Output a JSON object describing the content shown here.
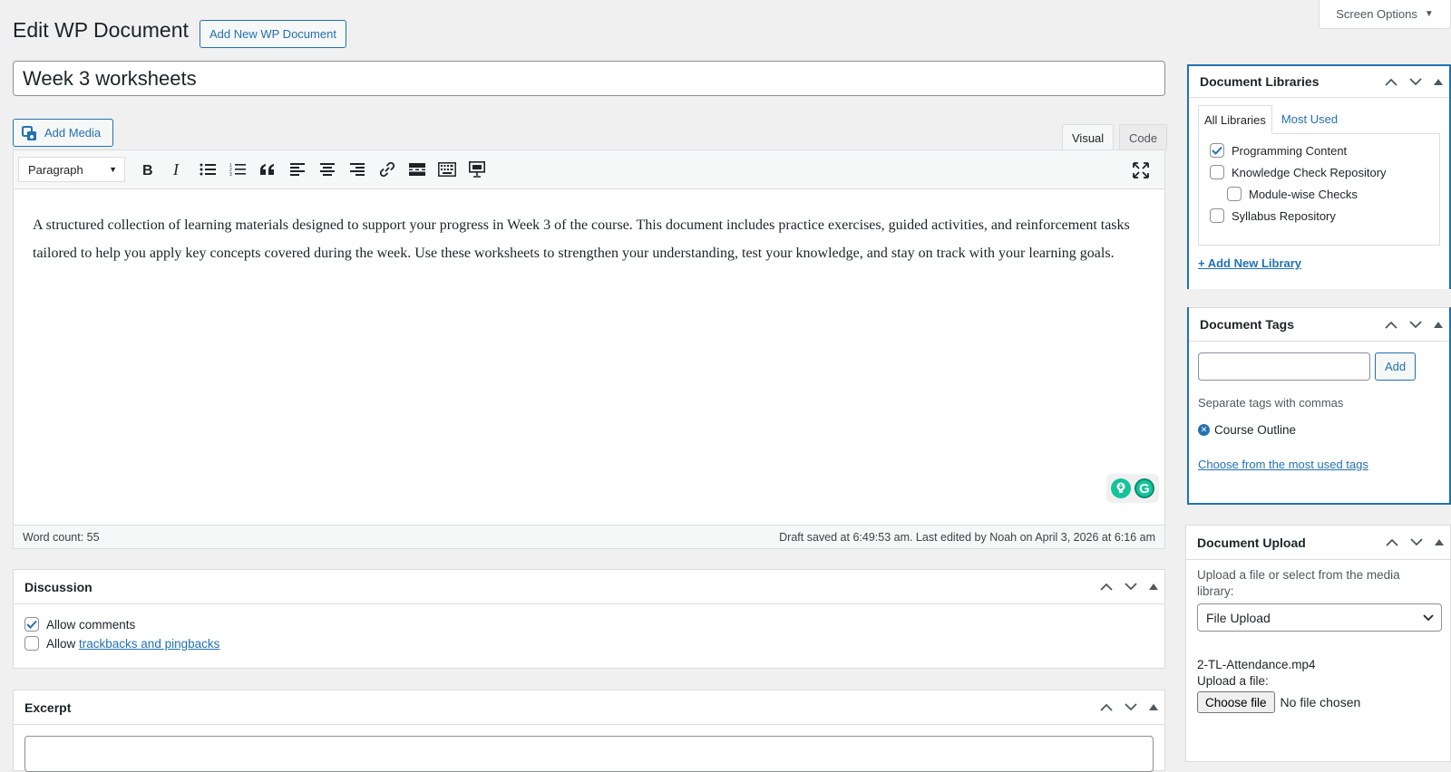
{
  "screen_options": {
    "label": "Screen Options"
  },
  "header": {
    "title": "Edit WP Document",
    "add_new_label": "Add New WP Document"
  },
  "post": {
    "title": "Week 3 worksheets"
  },
  "editor": {
    "add_media_label": "Add Media",
    "tabs": {
      "visual": "Visual",
      "code": "Code"
    },
    "format_value": "Paragraph",
    "content": "A structured collection of learning materials designed to support your progress in Week 3 of the course. This document includes practice exercises, guided activities, and reinforcement tasks tailored to help you apply key concepts covered during the week. Use these worksheets to strengthen your understanding, test your knowledge, and stay on track with your learning goals.",
    "word_count": "Word count: 55",
    "draft_status": "Draft saved at 6:49:53 am. Last edited by Noah on April 3, 2026 at 6:16 am",
    "grammarly_letter": "G"
  },
  "discussion": {
    "title": "Discussion",
    "allow_comments": "Allow comments",
    "allow_prefix": "Allow",
    "trackbacks_link": "trackbacks and pingbacks"
  },
  "excerpt": {
    "title": "Excerpt"
  },
  "libraries": {
    "title": "Document Libraries",
    "tab_all": "All Libraries",
    "tab_most_used": "Most Used",
    "items": [
      {
        "label": "Programming Content",
        "checked": true
      },
      {
        "label": "Knowledge Check Repository",
        "checked": false
      },
      {
        "label": "Module-wise Checks",
        "checked": false
      },
      {
        "label": "Syllabus Repository",
        "checked": false
      }
    ],
    "add_new_label": "+ Add New Library"
  },
  "tags": {
    "title": "Document Tags",
    "add_label": "Add",
    "hint": "Separate tags with commas",
    "items": [
      "Course Outline"
    ],
    "choose_link": "Choose from the most used tags"
  },
  "upload": {
    "title": "Document Upload",
    "description": "Upload a file or select from the media library:",
    "select_value": "File Upload",
    "filename": "2-TL-Attendance.mp4",
    "upload_label": "Upload a file:",
    "choose_file_label": "Choose file",
    "no_file_label": "No file chosen"
  },
  "colors": {
    "accent": "#2271b1",
    "background": "#f0f0f1",
    "grammarly_green": "#15c39a"
  }
}
